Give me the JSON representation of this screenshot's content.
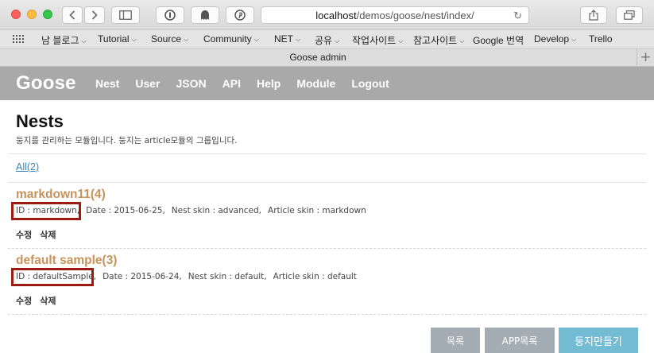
{
  "browser": {
    "url_host": "localhost",
    "url_path": "/demos/goose/nest/index/",
    "tab_title": "Goose admin",
    "new_tab_label": "+",
    "bookmarks": [
      {
        "label": "남 블로그"
      },
      {
        "label": "Tutorial"
      },
      {
        "label": "Source"
      },
      {
        "label": "Community"
      },
      {
        "label": "NET"
      },
      {
        "label": "공유"
      },
      {
        "label": "작업사이트"
      },
      {
        "label": "참고사이트"
      },
      {
        "label": "Google 번역"
      },
      {
        "label": "Develop"
      },
      {
        "label": "Trello"
      }
    ]
  },
  "app": {
    "logo": "Goose",
    "nav": [
      "Nest",
      "User",
      "JSON",
      "API",
      "Help",
      "Module",
      "Logout"
    ]
  },
  "page": {
    "title": "Nests",
    "description": "둥지를 관리하는 모듈입니다. 둥지는 article모듈의 그룹입니다.",
    "all_link": "All(2)"
  },
  "nests": [
    {
      "title": "markdown11(4)",
      "id_text": "ID : markdown,",
      "date_text": "Date : 2015-06-25,",
      "nest_skin_text": "Nest skin : advanced,",
      "article_skin_text": "Article skin : markdown",
      "edit_label": "수정",
      "delete_label": "삭제"
    },
    {
      "title": "default sample(3)",
      "id_text": "ID : defaultSample,",
      "date_text": "Date : 2015-06-24,",
      "nest_skin_text": "Nest skin : default,",
      "article_skin_text": "Article skin : default",
      "edit_label": "수정",
      "delete_label": "삭제"
    }
  ],
  "buttons": {
    "list": "목록",
    "app_list": "APP목록",
    "create": "둥지만들기"
  },
  "colors": {
    "nav_bg": "#a9a9a9",
    "nest_title": "#c7935a",
    "link": "#3a86b8",
    "highlight_box": "#9b1b13",
    "button_gray": "#a4adb4",
    "button_primary": "#74bcd4"
  }
}
